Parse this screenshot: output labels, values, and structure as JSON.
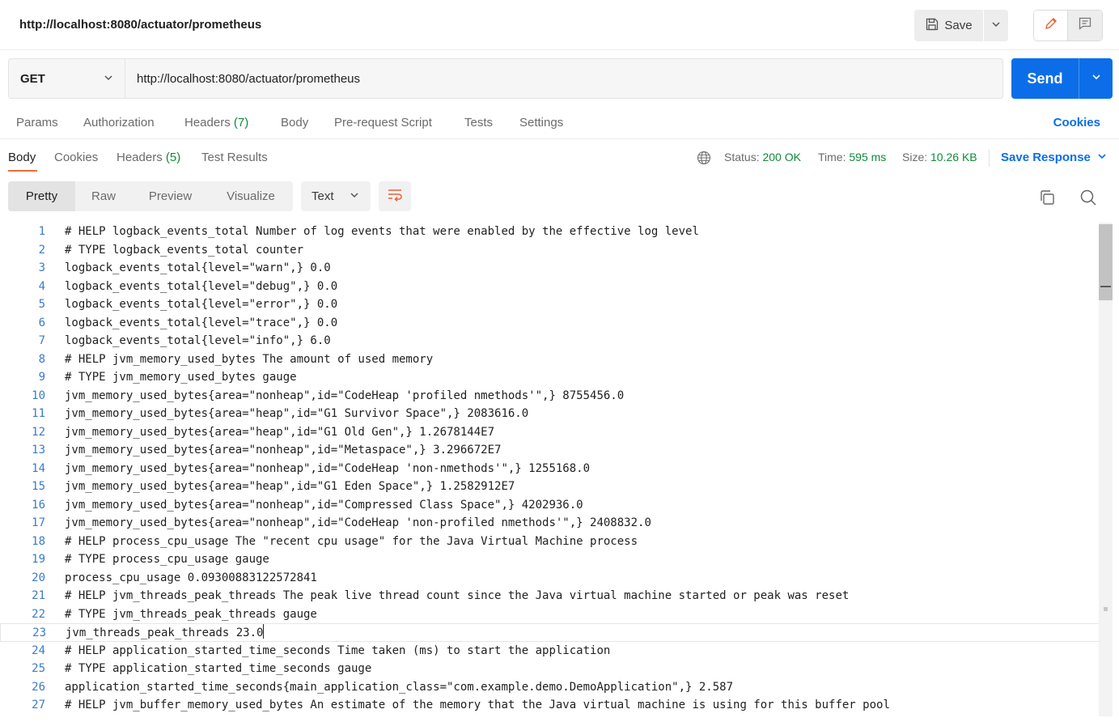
{
  "topbar": {
    "title": "http://localhost:8080/actuator/prometheus",
    "save_label": "Save"
  },
  "request": {
    "method": "GET",
    "url": "http://localhost:8080/actuator/prometheus",
    "send_label": "Send"
  },
  "request_tabs": {
    "params": "Params",
    "authorization": "Authorization",
    "headers": "Headers",
    "headers_count": "(7)",
    "body": "Body",
    "prerequest": "Pre-request Script",
    "tests": "Tests",
    "settings": "Settings",
    "cookies": "Cookies"
  },
  "response_tabs": {
    "body": "Body",
    "cookies": "Cookies",
    "headers": "Headers",
    "headers_count": "(5)",
    "test_results": "Test Results"
  },
  "status": {
    "status_label": "Status:",
    "status_value": "200 OK",
    "time_label": "Time:",
    "time_value": "595 ms",
    "size_label": "Size:",
    "size_value": "10.26 KB",
    "save_response": "Save Response"
  },
  "view_modes": [
    "Pretty",
    "Raw",
    "Preview",
    "Visualize"
  ],
  "format": "Text",
  "colors": {
    "accent": "#0b6ee8",
    "success": "#0f8a3a",
    "active_tab": "#f26b3a"
  },
  "icons": {
    "save": "floppy-disk-icon",
    "edit": "pencil-icon",
    "comment": "comment-icon",
    "globe": "globe-icon",
    "wrap": "word-wrap-icon",
    "copy": "copy-icon",
    "search": "search-icon"
  },
  "code": {
    "cursor_line": 23,
    "lines": [
      {
        "n": "1",
        "t": "# HELP logback_events_total Number of log events that were enabled by the effective log level"
      },
      {
        "n": "2",
        "t": "# TYPE logback_events_total counter"
      },
      {
        "n": "3",
        "t": "logback_events_total{level=\"warn\",} 0.0"
      },
      {
        "n": "4",
        "t": "logback_events_total{level=\"debug\",} 0.0"
      },
      {
        "n": "5",
        "t": "logback_events_total{level=\"error\",} 0.0"
      },
      {
        "n": "6",
        "t": "logback_events_total{level=\"trace\",} 0.0"
      },
      {
        "n": "7",
        "t": "logback_events_total{level=\"info\",} 6.0"
      },
      {
        "n": "8",
        "t": "# HELP jvm_memory_used_bytes The amount of used memory"
      },
      {
        "n": "9",
        "t": "# TYPE jvm_memory_used_bytes gauge"
      },
      {
        "n": "10",
        "t": "jvm_memory_used_bytes{area=\"nonheap\",id=\"CodeHeap 'profiled nmethods'\",} 8755456.0"
      },
      {
        "n": "11",
        "t": "jvm_memory_used_bytes{area=\"heap\",id=\"G1 Survivor Space\",} 2083616.0"
      },
      {
        "n": "12",
        "t": "jvm_memory_used_bytes{area=\"heap\",id=\"G1 Old Gen\",} 1.2678144E7"
      },
      {
        "n": "13",
        "t": "jvm_memory_used_bytes{area=\"nonheap\",id=\"Metaspace\",} 3.296672E7"
      },
      {
        "n": "14",
        "t": "jvm_memory_used_bytes{area=\"nonheap\",id=\"CodeHeap 'non-nmethods'\",} 1255168.0"
      },
      {
        "n": "15",
        "t": "jvm_memory_used_bytes{area=\"heap\",id=\"G1 Eden Space\",} 1.2582912E7"
      },
      {
        "n": "16",
        "t": "jvm_memory_used_bytes{area=\"nonheap\",id=\"Compressed Class Space\",} 4202936.0"
      },
      {
        "n": "17",
        "t": "jvm_memory_used_bytes{area=\"nonheap\",id=\"CodeHeap 'non-profiled nmethods'\",} 2408832.0"
      },
      {
        "n": "18",
        "t": "# HELP process_cpu_usage The \"recent cpu usage\" for the Java Virtual Machine process"
      },
      {
        "n": "19",
        "t": "# TYPE process_cpu_usage gauge"
      },
      {
        "n": "20",
        "t": "process_cpu_usage 0.09300883122572841"
      },
      {
        "n": "21",
        "t": "# HELP jvm_threads_peak_threads The peak live thread count since the Java virtual machine started or peak was reset"
      },
      {
        "n": "22",
        "t": "# TYPE jvm_threads_peak_threads gauge"
      },
      {
        "n": "23",
        "t": "jvm_threads_peak_threads 23.0"
      },
      {
        "n": "24",
        "t": "# HELP application_started_time_seconds Time taken (ms) to start the application"
      },
      {
        "n": "25",
        "t": "# TYPE application_started_time_seconds gauge"
      },
      {
        "n": "26",
        "t": "application_started_time_seconds{main_application_class=\"com.example.demo.DemoApplication\",} 2.587"
      },
      {
        "n": "27",
        "t": "# HELP jvm_buffer_memory_used_bytes An estimate of the memory that the Java virtual machine is using for this buffer pool"
      }
    ]
  }
}
